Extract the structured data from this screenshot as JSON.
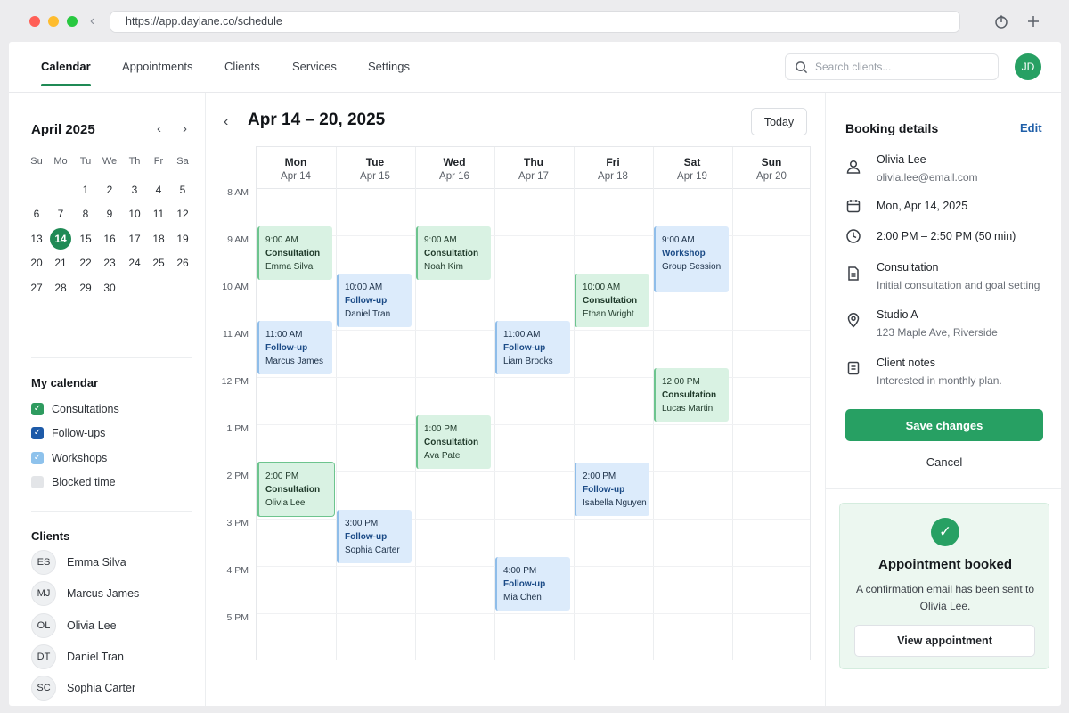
{
  "browser": {
    "url": "https://app.daylane.co/schedule",
    "icons": {
      "back": "chevron-left-icon",
      "share": "share-icon",
      "new_tab": "plus-icon"
    }
  },
  "nav": {
    "tabs": [
      {
        "label": "Calendar",
        "active": true
      },
      {
        "label": "Appointments",
        "active": false
      },
      {
        "label": "Clients",
        "active": false
      },
      {
        "label": "Services",
        "active": false
      },
      {
        "label": "Settings",
        "active": false
      }
    ],
    "search_placeholder": "Search clients...",
    "user_initials": "JD"
  },
  "mini_calendar": {
    "title": "April 2025",
    "weekdays": [
      "Su",
      "Mo",
      "Tu",
      "We",
      "Th",
      "Fr",
      "Sa"
    ],
    "weeks": [
      [
        "",
        "",
        "1",
        "2",
        "3",
        "4",
        "5"
      ],
      [
        "6",
        "7",
        "8",
        "9",
        "10",
        "11",
        "12"
      ],
      [
        "13",
        "14",
        "15",
        "16",
        "17",
        "18",
        "19"
      ],
      [
        "20",
        "21",
        "22",
        "23",
        "24",
        "25",
        "26"
      ],
      [
        "27",
        "28",
        "29",
        "30",
        "",
        "",
        ""
      ]
    ],
    "selected_day": "14"
  },
  "my_calendar": {
    "title": "My calendar",
    "items": [
      {
        "label": "Consultations",
        "checked": true,
        "color": "#2e9b5f"
      },
      {
        "label": "Follow-ups",
        "checked": true,
        "color": "#1d5aa8"
      },
      {
        "label": "Workshops",
        "checked": true,
        "color": "#8ec2ec"
      },
      {
        "label": "Blocked time",
        "checked": false,
        "color": "#e3e5e8"
      }
    ]
  },
  "clients": {
    "title": "Clients",
    "items": [
      {
        "initials": "ES",
        "name": "Emma Silva"
      },
      {
        "initials": "MJ",
        "name": "Marcus James"
      },
      {
        "initials": "OL",
        "name": "Olivia Lee"
      },
      {
        "initials": "DT",
        "name": "Daniel Tran"
      },
      {
        "initials": "SC",
        "name": "Sophia Carter"
      }
    ]
  },
  "week": {
    "title": "Apr 14 – 20, 2025",
    "today_label": "Today",
    "days": [
      {
        "name": "Mon",
        "date": "Apr 14"
      },
      {
        "name": "Tue",
        "date": "Apr 15"
      },
      {
        "name": "Wed",
        "date": "Apr 16"
      },
      {
        "name": "Thu",
        "date": "Apr 17"
      },
      {
        "name": "Fri",
        "date": "Apr 18"
      },
      {
        "name": "Sat",
        "date": "Apr 19"
      },
      {
        "name": "Sun",
        "date": "Apr 20"
      }
    ],
    "time_labels": [
      "8 AM",
      "9 AM",
      "10 AM",
      "11 AM",
      "12 PM",
      "1 PM",
      "2 PM",
      "3 PM",
      "4 PM",
      "5 PM"
    ],
    "events": [
      {
        "day": 0,
        "start": 9,
        "time": "9:00 AM",
        "title": "Consultation",
        "client": "Emma Silva",
        "kind": "green"
      },
      {
        "day": 0,
        "start": 11,
        "time": "11:00 AM",
        "title": "Follow-up",
        "client": "Marcus James",
        "kind": "blue"
      },
      {
        "day": 0,
        "start": 14,
        "time": "2:00 PM",
        "title": "Consultation",
        "client": "Olivia Lee",
        "kind": "green",
        "selected": true
      },
      {
        "day": 1,
        "start": 10,
        "time": "10:00 AM",
        "title": "Follow-up",
        "client": "Daniel Tran",
        "kind": "blue"
      },
      {
        "day": 1,
        "start": 15,
        "time": "3:00 PM",
        "title": "Follow-up",
        "client": "Sophia Carter",
        "kind": "blue"
      },
      {
        "day": 2,
        "start": 9,
        "time": "9:00 AM",
        "title": "Consultation",
        "client": "Noah Kim",
        "kind": "green"
      },
      {
        "day": 2,
        "start": 13,
        "time": "1:00 PM",
        "title": "Consultation",
        "client": "Ava Patel",
        "kind": "green"
      },
      {
        "day": 3,
        "start": 11,
        "time": "11:00 AM",
        "title": "Follow-up",
        "client": "Liam Brooks",
        "kind": "blue"
      },
      {
        "day": 3,
        "start": 16,
        "time": "4:00 PM",
        "title": "Follow-up",
        "client": "Mia Chen",
        "kind": "blue"
      },
      {
        "day": 4,
        "start": 10,
        "time": "10:00 AM",
        "title": "Consultation",
        "client": "Ethan Wright",
        "kind": "green"
      },
      {
        "day": 4,
        "start": 14,
        "time": "2:00 PM",
        "title": "Follow-up",
        "client": "Isabella Nguyen",
        "kind": "blue"
      },
      {
        "day": 5,
        "start": 9,
        "time": "9:00 AM",
        "title": "Workshop",
        "client": "Group Session",
        "kind": "blue"
      },
      {
        "day": 5,
        "start": 12,
        "time": "12:00 PM",
        "title": "Consultation",
        "client": "Lucas Martin",
        "kind": "green"
      }
    ]
  },
  "booking": {
    "title": "Booking details",
    "edit_label": "Edit",
    "client_name": "Olivia Lee",
    "client_email": "olivia.lee@email.com",
    "date": "Mon, Apr 14, 2025",
    "time": "2:00 PM – 2:50 PM (50 min)",
    "service": "Consultation",
    "service_desc": "Initial consultation and goal setting",
    "location": "Studio A",
    "address": "123 Maple Ave, Riverside",
    "notes_label": "Client notes",
    "notes": "Interested in monthly plan.",
    "save_label": "Save changes",
    "cancel_label": "Cancel"
  },
  "confirmation": {
    "title": "Appointment booked",
    "message": "A confirmation email has been sent to Olivia Lee.",
    "button_label": "View appointment"
  },
  "colors": {
    "accent": "#27a063",
    "link": "#1f5fa8",
    "event_green_bg": "#d9f2e3",
    "event_blue_bg": "#dcebfb"
  }
}
